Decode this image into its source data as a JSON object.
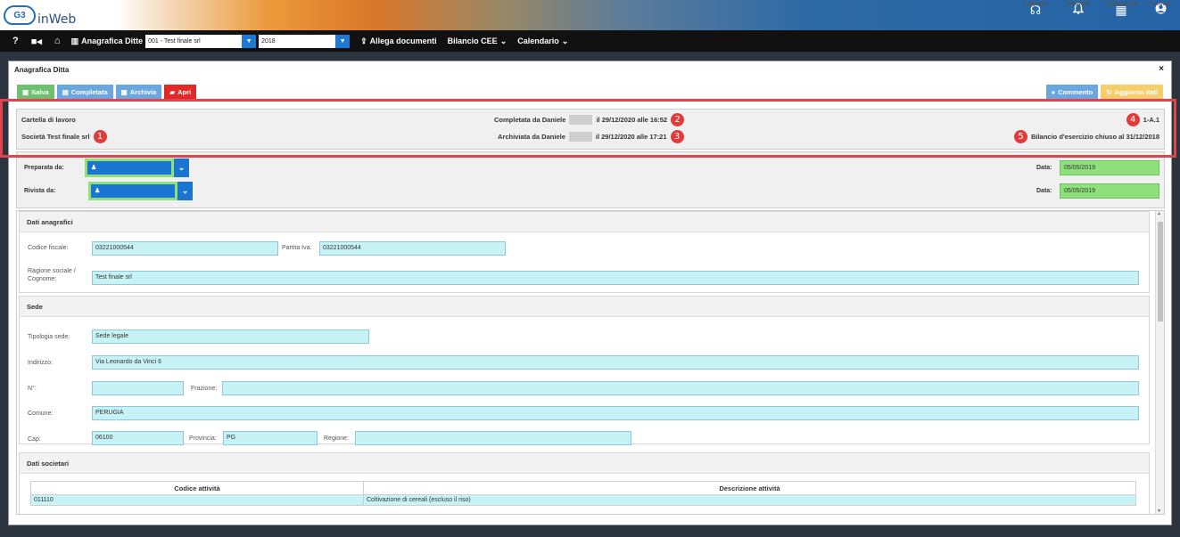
{
  "app": {
    "logo_text": "inWeb",
    "logo_mark": "G3"
  },
  "top_icons": [
    {
      "name": "supporto",
      "label": "Supporto",
      "icon": "headset-icon",
      "glyph": "☊"
    },
    {
      "name": "notifiche",
      "label": "Notifiche",
      "icon": "bell-icon",
      "glyph": "♫"
    },
    {
      "name": "applicazioni",
      "label": "Applicazioni",
      "icon": "grid-icon",
      "glyph": "▦"
    },
    {
      "name": "account",
      "label": "Account",
      "icon": "user-circle-icon",
      "glyph": "●"
    }
  ],
  "nav": {
    "help": "?",
    "anagrafica_label": "Anagrafica Ditte",
    "company_select": "001 - Test finale srl",
    "year_select": "2018",
    "allega": "Allega documenti",
    "bilancio": "Bilancio CEE",
    "calendario": "Calendario"
  },
  "window": {
    "title": "Anagrafica Ditta",
    "close": "×"
  },
  "toolbar": {
    "salva": "Salva",
    "completata": "Completata",
    "archivia": "Archivia",
    "apri": "Apri",
    "commento": "Commento",
    "aggiorna": "Aggiorna dati"
  },
  "info": {
    "cartella": "Cartella di lavoro",
    "societa": "Società Test finale srl",
    "completata_prefix": "Completata da Daniele",
    "completata_suffix": "il 29/12/2020 alle 16:52",
    "archiviata_prefix": "Archiviata da Daniele",
    "archiviata_suffix": "il 29/12/2020 alle 17:21",
    "code": "1-A.1",
    "bilancio": "Bilancio d'esercizio chiuso al 31/12/2018",
    "badges": [
      "1",
      "2",
      "3",
      "4",
      "5"
    ]
  },
  "prep": {
    "preparata_label": "Preparata da:",
    "rivista_label": "Rivista da:",
    "data_label": "Data:",
    "data1": "05/05/2019",
    "data2": "05/05/2019"
  },
  "anagrafici": {
    "title": "Dati anagrafici",
    "cf_label": "Codice fiscale:",
    "cf": "03221000544",
    "piva_label": "Partita Iva:",
    "piva": "03221000544",
    "ragione_label_1": "Ragione sociale /",
    "ragione_label_2": "Cognome:",
    "ragione": "Test finale srl"
  },
  "sede": {
    "title": "Sede",
    "tipologia_label": "Tipologia sede:",
    "tipologia": "Sede legale",
    "indirizzo_label": "Indirizzo:",
    "indirizzo": "Via Leonardo da Vinci 6",
    "numero_label": "N°:",
    "numero": "",
    "frazione_label": "Frazione:",
    "frazione": "",
    "comune_label": "Comune:",
    "comune": "PERUGIA",
    "cap_label": "Cap:",
    "cap": "06100",
    "provincia_label": "Provincia:",
    "provincia": "PG",
    "regione_label": "Regione:",
    "regione": ""
  },
  "societari": {
    "title": "Dati societari",
    "col_codice": "Codice attività",
    "col_descr": "Descrizione attività",
    "rows": [
      {
        "codice": "011110",
        "descr": "Coltivazione di cereali (escluso il riso)"
      }
    ]
  }
}
